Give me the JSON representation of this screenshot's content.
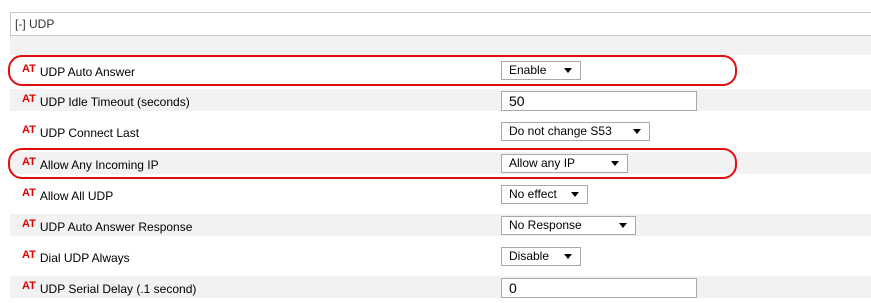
{
  "section": {
    "toggle_label": "[-] UDP"
  },
  "at_tag": "AT",
  "rows": [
    {
      "label": "UDP Auto Answer",
      "type": "select",
      "value": "Enable"
    },
    {
      "label": "UDP Idle Timeout (seconds)",
      "type": "input",
      "value": "50"
    },
    {
      "label": "UDP Connect Last",
      "type": "select",
      "value": "Do not change S53"
    },
    {
      "label": "Allow Any Incoming IP",
      "type": "select",
      "value": "Allow any IP"
    },
    {
      "label": "Allow All UDP",
      "type": "select",
      "value": "No effect"
    },
    {
      "label": "UDP Auto Answer Response",
      "type": "select",
      "value": "No Response"
    },
    {
      "label": "Dial UDP Always",
      "type": "select",
      "value": "Disable"
    },
    {
      "label": "UDP Serial Delay (.1 second)",
      "type": "input",
      "value": "0"
    }
  ],
  "annotation_color": "#e01010"
}
